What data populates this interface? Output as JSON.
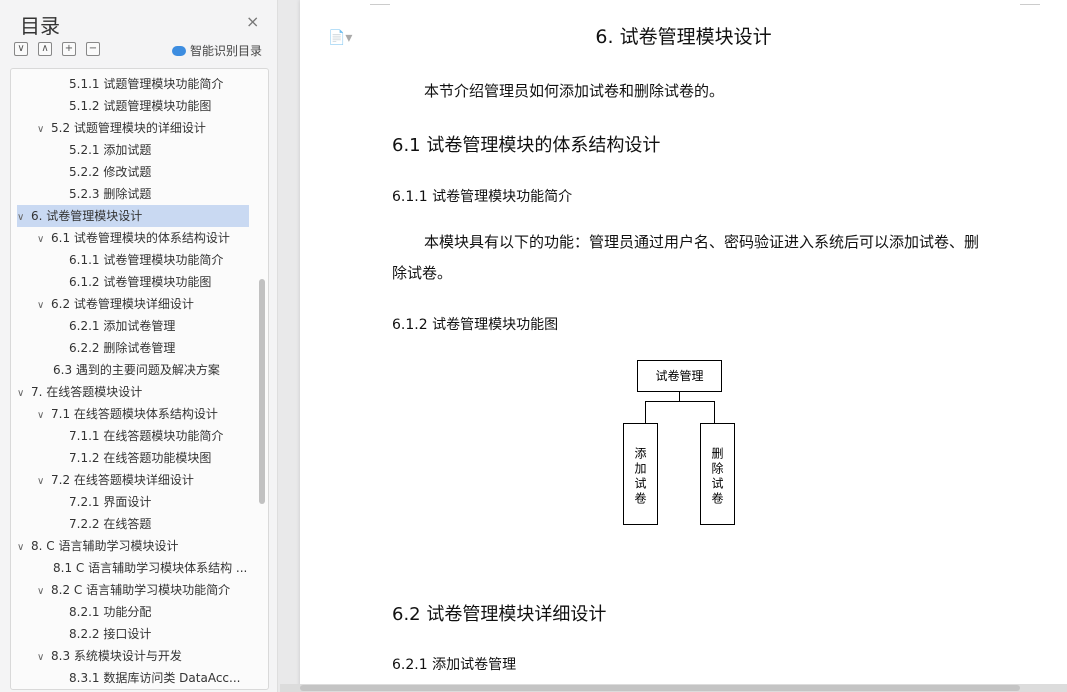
{
  "sidebar": {
    "title": "目录",
    "close_glyph": "×",
    "tools": [
      "∨",
      "∧",
      "+",
      "−"
    ],
    "smart_label": "智能识别目录",
    "items": [
      {
        "label": "5.1.1  试题管理模块功能简介",
        "level": 3,
        "chev": ""
      },
      {
        "label": "5.1.2  试题管理模块功能图",
        "level": 3,
        "chev": ""
      },
      {
        "label": "5.2  试题管理模块的详细设计",
        "level": 2,
        "chev": "∨"
      },
      {
        "label": "5.2.1  添加试题",
        "level": 3,
        "chev": ""
      },
      {
        "label": "5.2.2  修改试题",
        "level": 3,
        "chev": ""
      },
      {
        "label": "5.2.3  删除试题",
        "level": 3,
        "chev": ""
      },
      {
        "label": "6.  试卷管理模块设计",
        "level": 1,
        "chev": "∨",
        "selected": true
      },
      {
        "label": "6.1 试卷管理模块的体系结构设计",
        "level": 2,
        "chev": "∨"
      },
      {
        "label": "6.1.1  试卷管理模块功能简介",
        "level": 3,
        "chev": ""
      },
      {
        "label": "6.1.2  试卷管理模块功能图",
        "level": 3,
        "chev": ""
      },
      {
        "label": "6.2  试卷管理模块详细设计",
        "level": 2,
        "chev": "∨"
      },
      {
        "label": "6.2.1  添加试卷管理",
        "level": 3,
        "chev": ""
      },
      {
        "label": "6.2.2  删除试卷管理",
        "level": 3,
        "chev": ""
      },
      {
        "label": "6.3  遇到的主要问题及解决方案",
        "level": 2,
        "chev": ""
      },
      {
        "label": "7.  在线答题模块设计",
        "level": 1,
        "chev": "∨"
      },
      {
        "label": "7.1  在线答题模块体系结构设计",
        "level": 2,
        "chev": "∨"
      },
      {
        "label": "7.1.1  在线答题模块功能简介",
        "level": 3,
        "chev": ""
      },
      {
        "label": "7.1.2  在线答题功能模块图",
        "level": 3,
        "chev": ""
      },
      {
        "label": "7.2  在线答题模块详细设计",
        "level": 2,
        "chev": "∨"
      },
      {
        "label": "7.2.1  界面设计",
        "level": 3,
        "chev": ""
      },
      {
        "label": "7.2.2  在线答题",
        "level": 3,
        "chev": ""
      },
      {
        "label": "8. C 语言辅助学习模块设计",
        "level": 1,
        "chev": "∨"
      },
      {
        "label": "8.1 C 语言辅助学习模块体系结构 ...",
        "level": 2,
        "chev": ""
      },
      {
        "label": "8.2 C 语言辅助学习模块功能简介",
        "level": 2,
        "chev": "∨"
      },
      {
        "label": "8.2.1  功能分配",
        "level": 3,
        "chev": ""
      },
      {
        "label": "8.2.2  接口设计",
        "level": 3,
        "chev": ""
      },
      {
        "label": "8.3  系统模块设计与开发",
        "level": 2,
        "chev": "∨"
      },
      {
        "label": "8.3.1  数据库访问类 DataAcc...",
        "level": 3,
        "chev": ""
      }
    ]
  },
  "doc": {
    "chapter_title": "6.  试卷管理模块设计",
    "intro": "本节介绍管理员如何添加试卷和删除试卷的。",
    "h_6_1": "6.1 试卷管理模块的体系结构设计",
    "h_6_1_1": "6.1.1  试卷管理模块功能简介",
    "para_line1": "本模块具有以下的功能：管理员通过用户名、密码验证进入系统后可以添加试卷、删",
    "para_line2": "除试卷。",
    "h_6_1_2": "6.1.2  试卷管理模块功能图",
    "diagram": {
      "root": "试卷管理",
      "left": "添加试卷",
      "right": "删除试卷"
    },
    "h_6_2": "6.2  试卷管理模块详细设计",
    "h_6_2_1": "6.2.1  添加试卷管理"
  },
  "icons": {
    "doc_icon": "document-icon",
    "close": "close-icon",
    "smart": "cloud-icon"
  },
  "colors": {
    "selection": "#c9d9f2",
    "accent": "#3d8de0"
  }
}
